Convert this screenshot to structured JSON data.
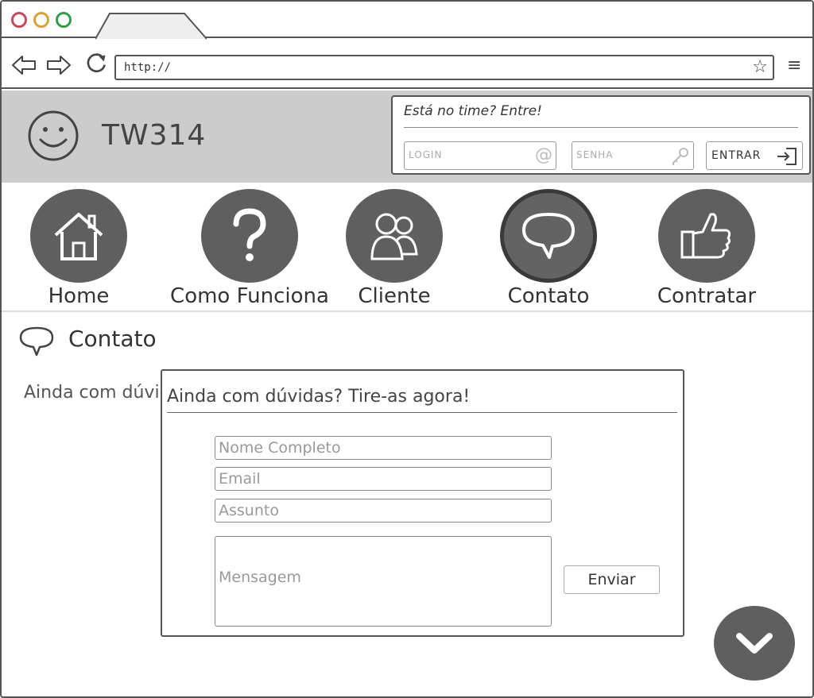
{
  "browser": {
    "url": "http://",
    "menu_icon": "hamburger-icon"
  },
  "header": {
    "brand": "TW314",
    "login": {
      "title": "Está no time? Entre!",
      "login_placeholder": "LOGIN",
      "password_placeholder": "SENHA",
      "submit_label": "ENTRAR"
    }
  },
  "nav": {
    "items": [
      {
        "label": "Home",
        "icon": "house-icon"
      },
      {
        "label": "Como Funciona",
        "icon": "question-icon"
      },
      {
        "label": "Cliente",
        "icon": "people-icon"
      },
      {
        "label": "Contato",
        "icon": "speech-bubble-icon",
        "active": true
      },
      {
        "label": "Contratar",
        "icon": "thumbs-up-icon"
      }
    ]
  },
  "section": {
    "title": "Contato",
    "intro": "Ainda com dúvio"
  },
  "contact_form": {
    "title": "Ainda com dúvidas? Tire-as agora!",
    "name_placeholder": "Nome Completo",
    "email_placeholder": "Email",
    "subject_placeholder": "Assunto",
    "message_placeholder": "Mensagem",
    "submit_label": "Enviar"
  },
  "colors": {
    "header_bg": "#cccccc",
    "circle_bg": "#5f5f5f",
    "stroke": "#555555"
  }
}
